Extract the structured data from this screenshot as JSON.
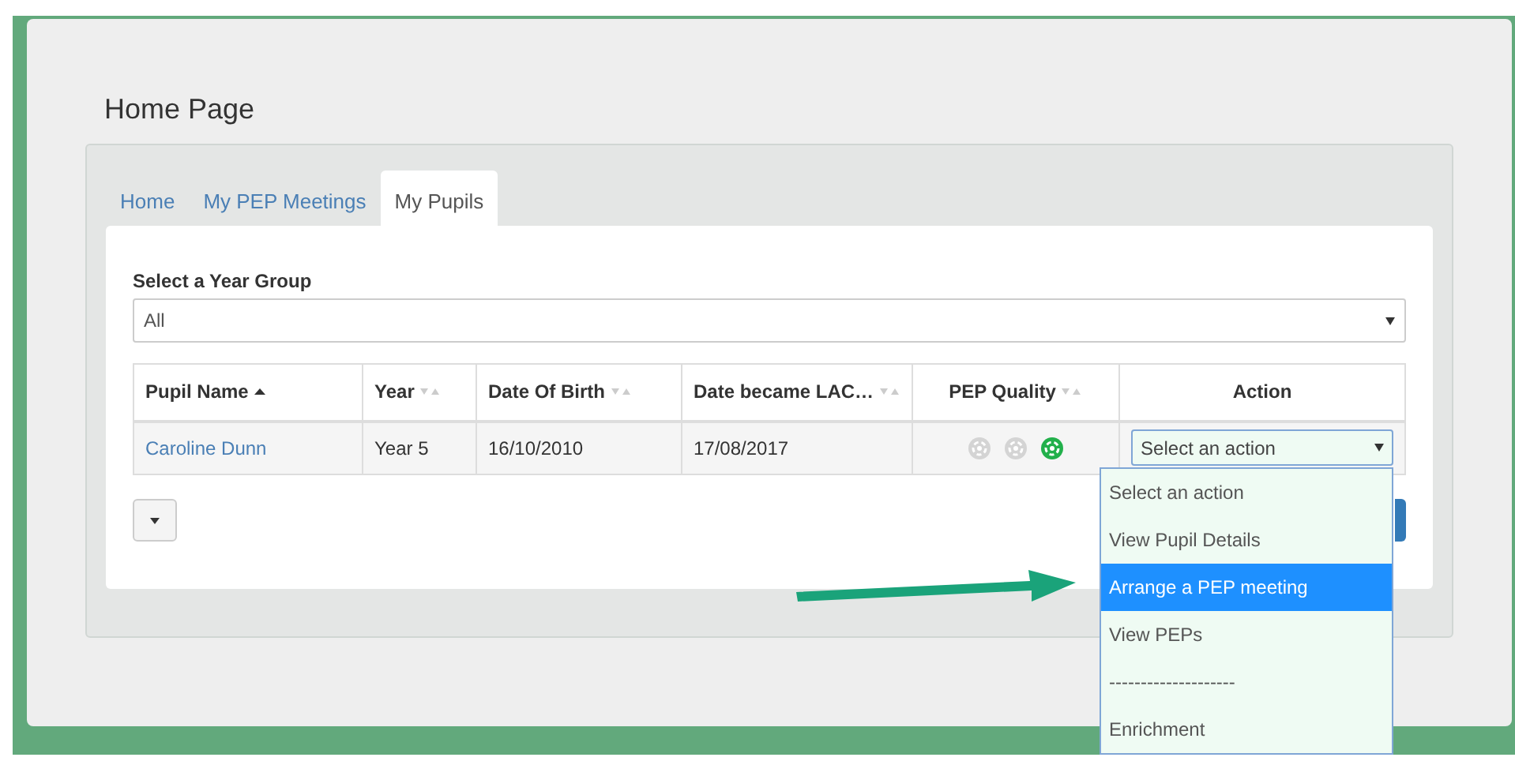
{
  "page": {
    "title": "Home Page"
  },
  "tabs": [
    {
      "label": "Home",
      "selected": false
    },
    {
      "label": "My PEP Meetings",
      "selected": false
    },
    {
      "label": "My Pupils",
      "selected": true
    }
  ],
  "year_group": {
    "label": "Select a Year Group",
    "value": "All"
  },
  "table": {
    "columns": [
      {
        "label": "Pupil Name",
        "sorted": true
      },
      {
        "label": "Year",
        "sorted": false
      },
      {
        "label": "Date Of Birth",
        "sorted": false
      },
      {
        "label": "Date became LAC…",
        "sorted": false
      },
      {
        "label": "PEP Quality",
        "sorted": false
      },
      {
        "label": "Action"
      }
    ],
    "rows": [
      {
        "pupil_name": "Caroline Dunn",
        "year": "Year 5",
        "date_of_birth": "16/10/2010",
        "date_became_lac": "17/08/2017",
        "pep_quality": [
          {
            "on": false
          },
          {
            "on": false
          },
          {
            "on": true
          }
        ],
        "action": {
          "value": "Select an action",
          "expanded": true,
          "options": [
            {
              "label": "Select an action",
              "highlighted": false
            },
            {
              "label": "View Pupil Details",
              "highlighted": false
            },
            {
              "label": "Arrange a PEP meeting",
              "highlighted": true
            },
            {
              "label": "View PEPs",
              "highlighted": false
            },
            {
              "label": "--------------------",
              "highlighted": false
            },
            {
              "label": "Enrichment",
              "highlighted": false
            }
          ]
        }
      }
    ]
  }
}
